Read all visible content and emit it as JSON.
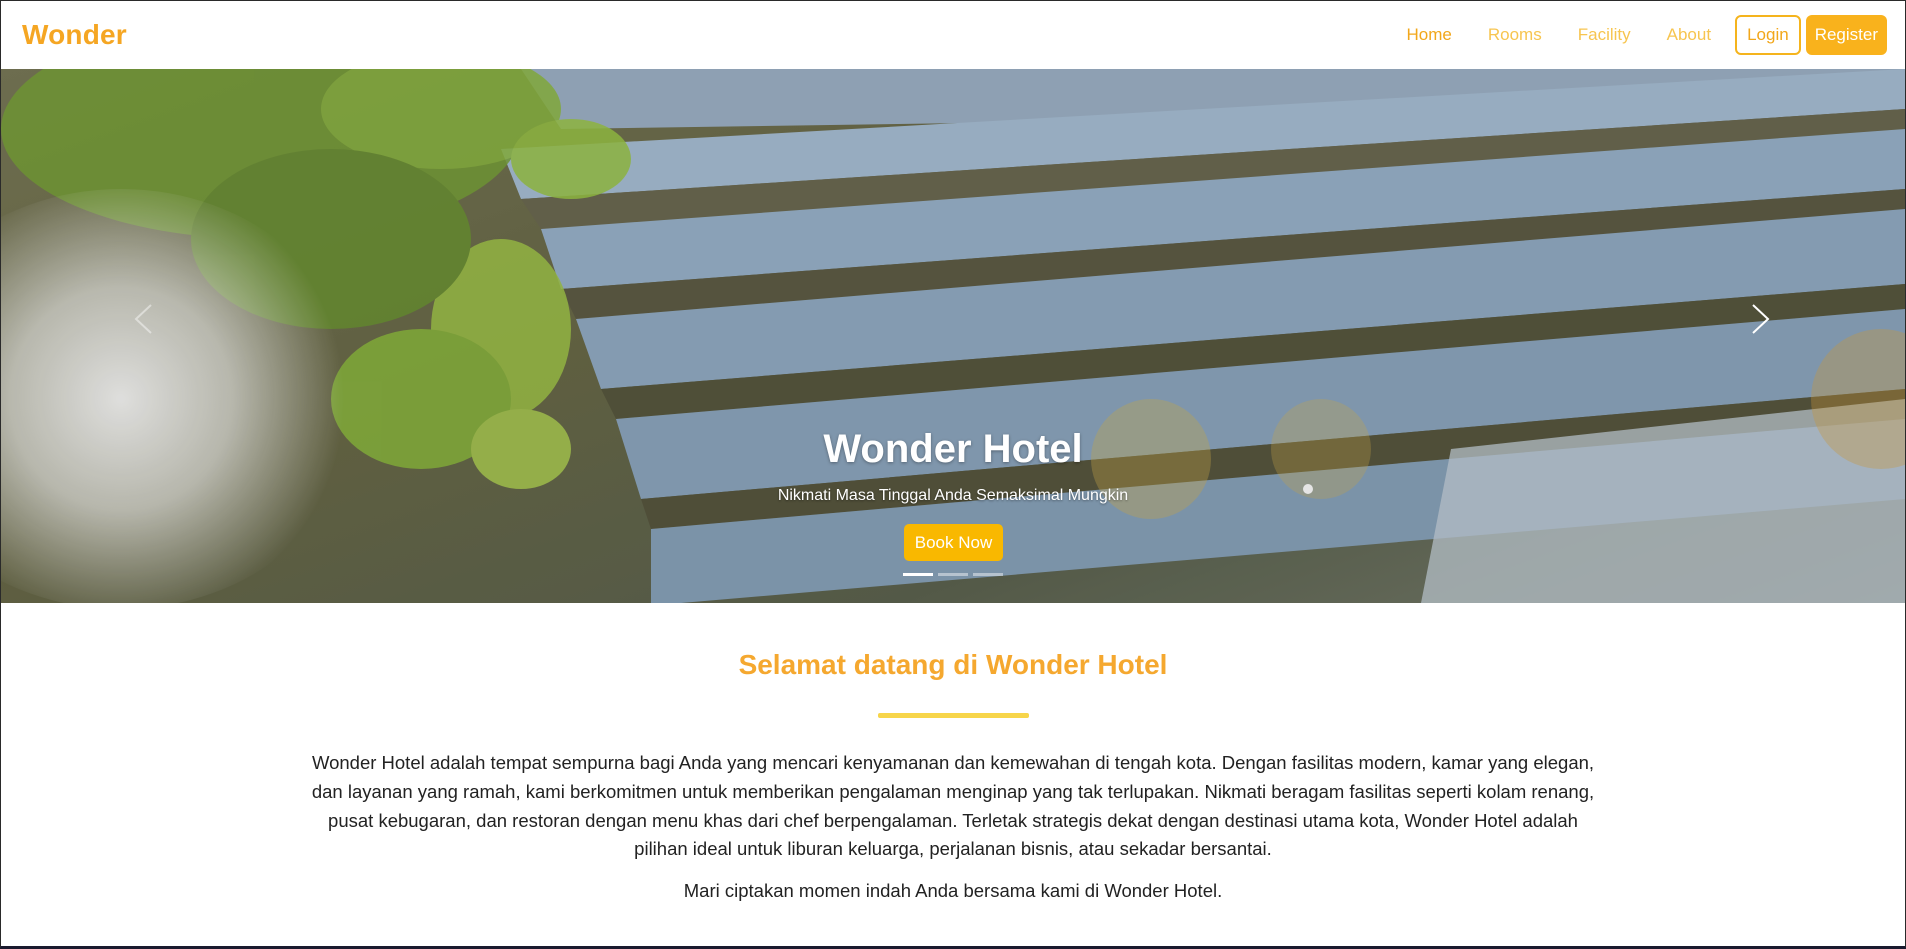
{
  "navbar": {
    "brand": "Wonder",
    "links": [
      "Home",
      "Rooms",
      "Facility",
      "About"
    ],
    "login_label": "Login",
    "register_label": "Register"
  },
  "hero": {
    "title": "Wonder Hotel",
    "subtitle": "Nikmati Masa Tinggal Anda Semaksimal Mungkin",
    "cta_label": "Book Now",
    "slide_count": 3,
    "active_slide": 1,
    "prev_icon": "chevron-left-icon",
    "next_icon": "chevron-right-icon"
  },
  "welcome": {
    "title": "Selamat datang di Wonder Hotel",
    "paragraph": "Wonder Hotel adalah tempat sempurna bagi Anda yang mencari kenyamanan dan kemewahan di tengah kota. Dengan fasilitas modern, kamar yang elegan, dan layanan yang ramah, kami berkomitmen untuk memberikan pengalaman menginap yang tak terlupakan. Nikmati beragam fasilitas seperti kolam renang, pusat kebugaran, dan restoran dengan menu khas dari chef berpengalaman. Terletak strategis dekat dengan destinasi utama kota, Wonder Hotel adalah pilihan ideal untuk liburan keluarga, perjalanan bisnis, atau sekadar bersantai.",
    "closing": "Mari ciptakan momen indah Anda bersama kami di Wonder Hotel."
  },
  "colors": {
    "accent": "#f5a623",
    "button": "#f9b800",
    "divider": "#f7d54a"
  }
}
